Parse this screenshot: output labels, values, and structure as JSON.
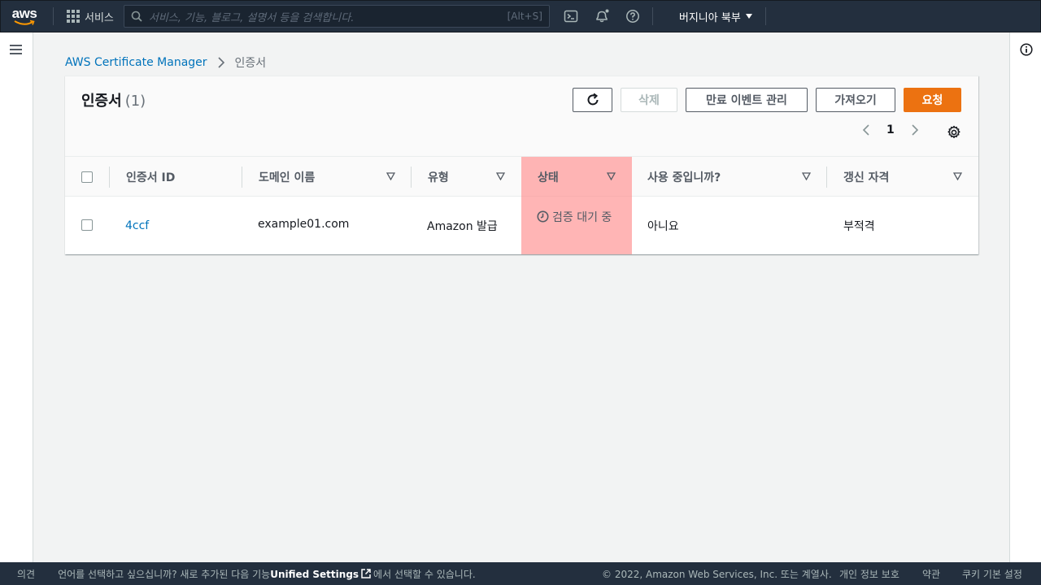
{
  "nav": {
    "logo_text": "aws",
    "services_label": "서비스",
    "search_placeholder": "서비스, 기능, 블로그, 설명서 등을 검색합니다.",
    "search_shortcut": "[Alt+S]",
    "region_label": "버지니아 북부"
  },
  "breadcrumb": {
    "root": "AWS Certificate Manager",
    "current": "인증서"
  },
  "panel": {
    "title": "인증서",
    "count": "(1)",
    "buttons": {
      "delete": "삭제",
      "manage_expiry": "만료 이벤트 관리",
      "import": "가져오기",
      "request": "요청"
    },
    "page_number": "1"
  },
  "table": {
    "columns": [
      "인증서 ID",
      "도메인 이름",
      "유형",
      "상태",
      "사용 중입니까?",
      "갱신 자격"
    ],
    "rows": [
      {
        "id": "4ccf",
        "domain": "example01.com",
        "type": "Amazon 발급",
        "status": "검증 대기 중",
        "in_use": "아니요",
        "renewal": "부적격"
      }
    ]
  },
  "footer": {
    "feedback": "의견",
    "lang_pre": "언어를 선택하고 싶으십니까? 새로 추가된 다음 기능",
    "unified": "Unified Settings",
    "lang_post": "에서 선택할 수 있습니다.",
    "copyright": "© 2022, Amazon Web Services, Inc. 또는 계열사.",
    "privacy": "개인 정보 보호",
    "terms": "약관",
    "cookie": "쿠키 기본 설정"
  },
  "colors": {
    "nav_bg": "#232f3e",
    "link": "#0073bb",
    "primary_button": "#ec7211",
    "status_highlight": "#ff9292"
  },
  "icons": [
    "aws-logo",
    "services-grid-icon",
    "search-icon",
    "cloudshell-icon",
    "bell-icon",
    "help-icon",
    "caret-down-icon",
    "hamburger-icon",
    "info-icon",
    "refresh-icon",
    "chevron-left-icon",
    "chevron-right-icon",
    "gear-icon",
    "sort-icon",
    "clock-icon",
    "external-link-icon"
  ]
}
